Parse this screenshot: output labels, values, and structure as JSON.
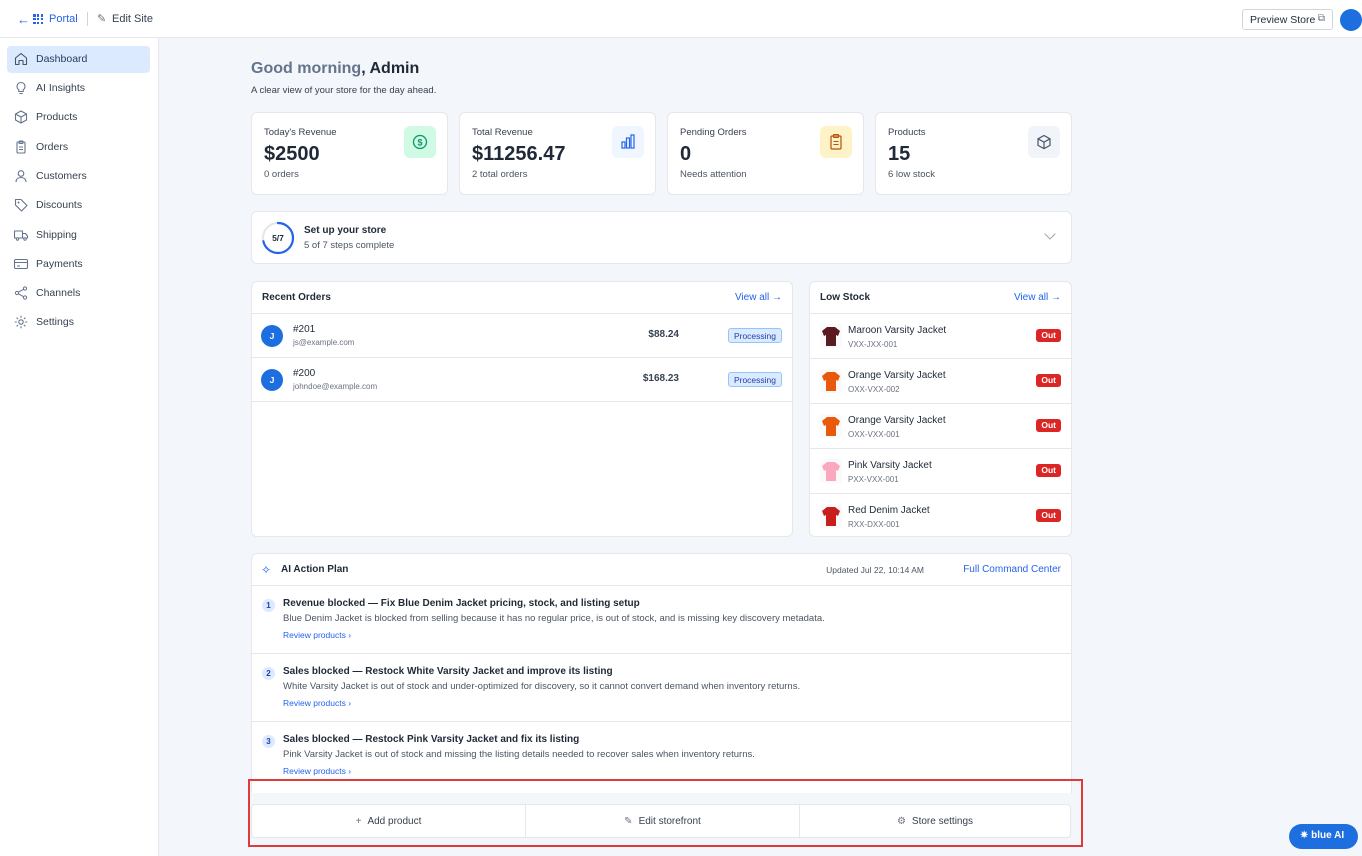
{
  "topbar": {
    "back_arrow": "←",
    "portal_label": "Portal",
    "edit_site_label": "Edit Site",
    "preview_store_label": "Preview Store"
  },
  "sidebar": {
    "items": [
      {
        "label": "Dashboard",
        "icon": "home-icon",
        "active": true
      },
      {
        "label": "AI Insights",
        "icon": "lightbulb-icon"
      },
      {
        "label": "Products",
        "icon": "box-icon"
      },
      {
        "label": "Orders",
        "icon": "clipboard-icon"
      },
      {
        "label": "Customers",
        "icon": "user-icon"
      },
      {
        "label": "Discounts",
        "icon": "tag-icon"
      },
      {
        "label": "Shipping",
        "icon": "truck-icon"
      },
      {
        "label": "Payments",
        "icon": "card-icon"
      },
      {
        "label": "Channels",
        "icon": "share-icon"
      },
      {
        "label": "Settings",
        "icon": "gear-icon"
      }
    ]
  },
  "greeting": {
    "prefix": "Good morning",
    "name": ", Admin",
    "subtitle": "A clear view of your store for the day ahead."
  },
  "stats": [
    {
      "title": "Today's Revenue",
      "value": "$2500",
      "note": "0 orders",
      "icon": "dollar-icon",
      "color": "#10b981"
    },
    {
      "title": "Total Revenue",
      "value": "$11256.47",
      "note": "2 total orders",
      "icon": "bar-chart-icon",
      "color": "#2563eb"
    },
    {
      "title": "Pending Orders",
      "value": "0",
      "note": "Needs attention",
      "icon": "clipboard-icon",
      "color": "#d97706"
    },
    {
      "title": "Products",
      "value": "15",
      "note": "6 low stock",
      "icon": "box-icon",
      "color": "#64748b"
    }
  ],
  "setup": {
    "ring_label": "5/7",
    "progress": 0.714,
    "title": "Set up your store",
    "subtitle": "5 of 7 steps complete"
  },
  "recent_orders": {
    "title": "Recent Orders",
    "view_all": "View all →",
    "rows": [
      {
        "initial": "J",
        "id": "#201",
        "email": "js@example.com",
        "amount": "$88.24",
        "status": "Processing"
      },
      {
        "initial": "J",
        "id": "#200",
        "email": "johndoe@example.com",
        "amount": "$168.23",
        "status": "Processing"
      }
    ]
  },
  "low_stock": {
    "title": "Low Stock",
    "view_all": "View all →",
    "rows": [
      {
        "name": "Maroon Varsity Jacket",
        "sku": "VXX-JXX-001",
        "badge": "Out",
        "color": "#5b1a1f"
      },
      {
        "name": "Orange Varsity Jacket",
        "sku": "OXX-VXX-002",
        "badge": "Out",
        "color": "#ea580c"
      },
      {
        "name": "Orange Varsity Jacket",
        "sku": "OXX-VXX-001",
        "badge": "Out",
        "color": "#ea580c"
      },
      {
        "name": "Pink Varsity Jacket",
        "sku": "PXX-VXX-001",
        "badge": "Out",
        "color": "#f9a8c0"
      },
      {
        "name": "Red Denim Jacket",
        "sku": "RXX-DXX-001",
        "badge": "Out",
        "color": "#c81e1e"
      }
    ]
  },
  "ai_plan": {
    "title": "AI Action Plan",
    "updated": "Updated Jul 22, 10:14 AM",
    "link": "Full Command Center",
    "items": [
      {
        "num": "1",
        "title": "Revenue blocked — Fix Blue Denim Jacket pricing, stock, and listing setup",
        "desc": "Blue Denim Jacket is blocked from selling because it has no regular price, is out of stock, and is missing key discovery metadata.",
        "link": "Review products ›"
      },
      {
        "num": "2",
        "title": "Sales blocked — Restock White Varsity Jacket and improve its listing",
        "desc": "White Varsity Jacket is out of stock and under-optimized for discovery, so it cannot convert demand when inventory returns.",
        "link": "Review products ›"
      },
      {
        "num": "3",
        "title": "Sales blocked — Restock Pink Varsity Jacket and fix its listing",
        "desc": "Pink Varsity Jacket is out of stock and missing the listing details needed to recover sales when inventory returns.",
        "link": "Review products ›"
      }
    ]
  },
  "quick_actions": [
    {
      "label": "Add product",
      "glyph": "+"
    },
    {
      "label": "Edit storefront",
      "glyph": "✎"
    },
    {
      "label": "Store settings",
      "glyph": "⚙"
    }
  ],
  "blue_ai": {
    "label": "blue AI",
    "glyph": "✷"
  }
}
